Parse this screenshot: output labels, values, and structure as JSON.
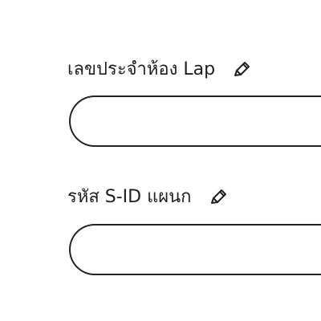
{
  "form": {
    "fields": [
      {
        "label": "เลขประจำห้อง Lap",
        "value": "",
        "edit_icon": "pencil-icon"
      },
      {
        "label": "รหัส S-ID แผนก",
        "value": "",
        "edit_icon": "pencil-icon"
      }
    ]
  },
  "colors": {
    "text": "#1f1f1f",
    "border": "#232323",
    "background": "#ffffff"
  }
}
